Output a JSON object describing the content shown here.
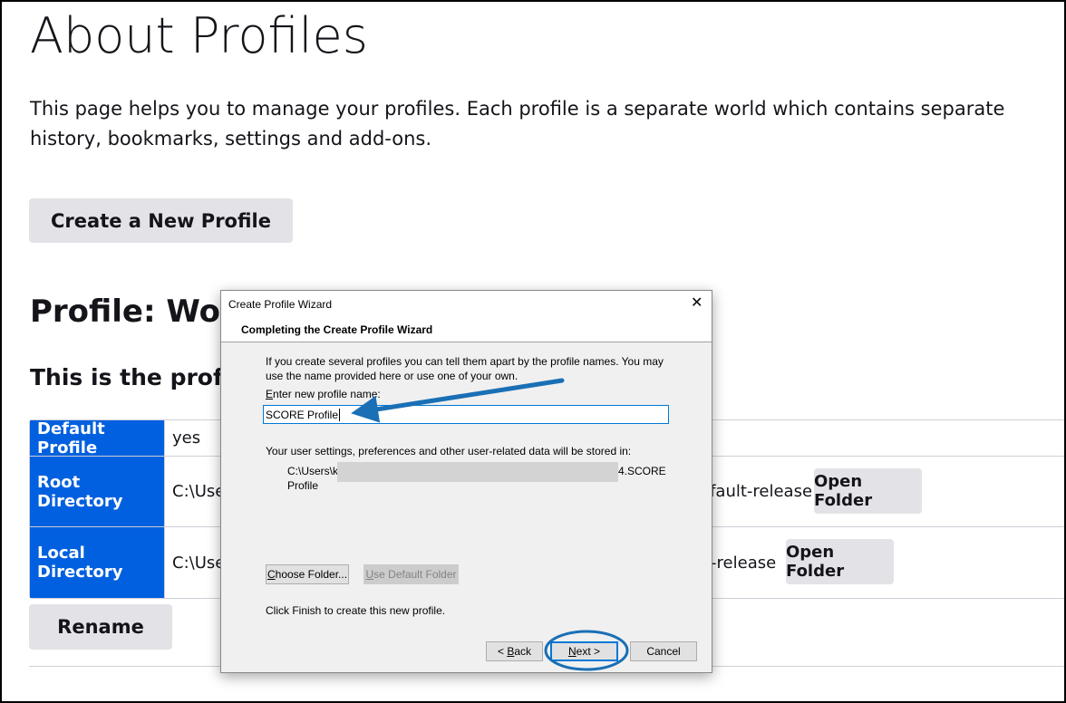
{
  "page": {
    "title": "About Profiles",
    "intro": "This page helps you to manage your profiles. Each profile is a separate world which contains separate history, bookmarks, settings and add-ons.",
    "create_button": "Create a New Profile",
    "profile_heading": "Profile: Work",
    "profile_subheading": "This is the profil",
    "rename_button": "Rename",
    "table": [
      {
        "label": "Default Profile",
        "value": "yes"
      },
      {
        "label": "Root Directory",
        "value_left": "C:\\Use",
        "value_right": "efault-release",
        "button": "Open Folder"
      },
      {
        "label": "Local Directory",
        "value_left": "C:\\Use",
        "value_right": "lt-release",
        "button": "Open Folder"
      }
    ]
  },
  "dialog": {
    "title": "Create Profile Wizard",
    "close": "✕",
    "header": "Completing the Create Profile Wizard",
    "description": "If you create several profiles you can tell them apart by the profile names. You may use the name provided here or use one of your own.",
    "name_label_accel": "E",
    "name_label_rest": "nter new profile name:",
    "name_value": "SCORE Profile",
    "storage_label": "Your user settings, preferences and other user-related data will be stored in:",
    "path_start": "C:\\Users\\k",
    "path_end": "4.SCORE",
    "path_line2": "Profile",
    "choose_folder_accel": "C",
    "choose_folder_rest": "hoose Folder...",
    "default_folder_accel": "U",
    "default_folder_rest": "se Default Folder",
    "finish_text": "Click Finish to create this new profile.",
    "back_pre": "< ",
    "back_accel": "B",
    "back_rest": "ack",
    "next_accel": "N",
    "next_rest": "ext >",
    "cancel": "Cancel"
  },
  "annotation_color": "#1a6fb5"
}
